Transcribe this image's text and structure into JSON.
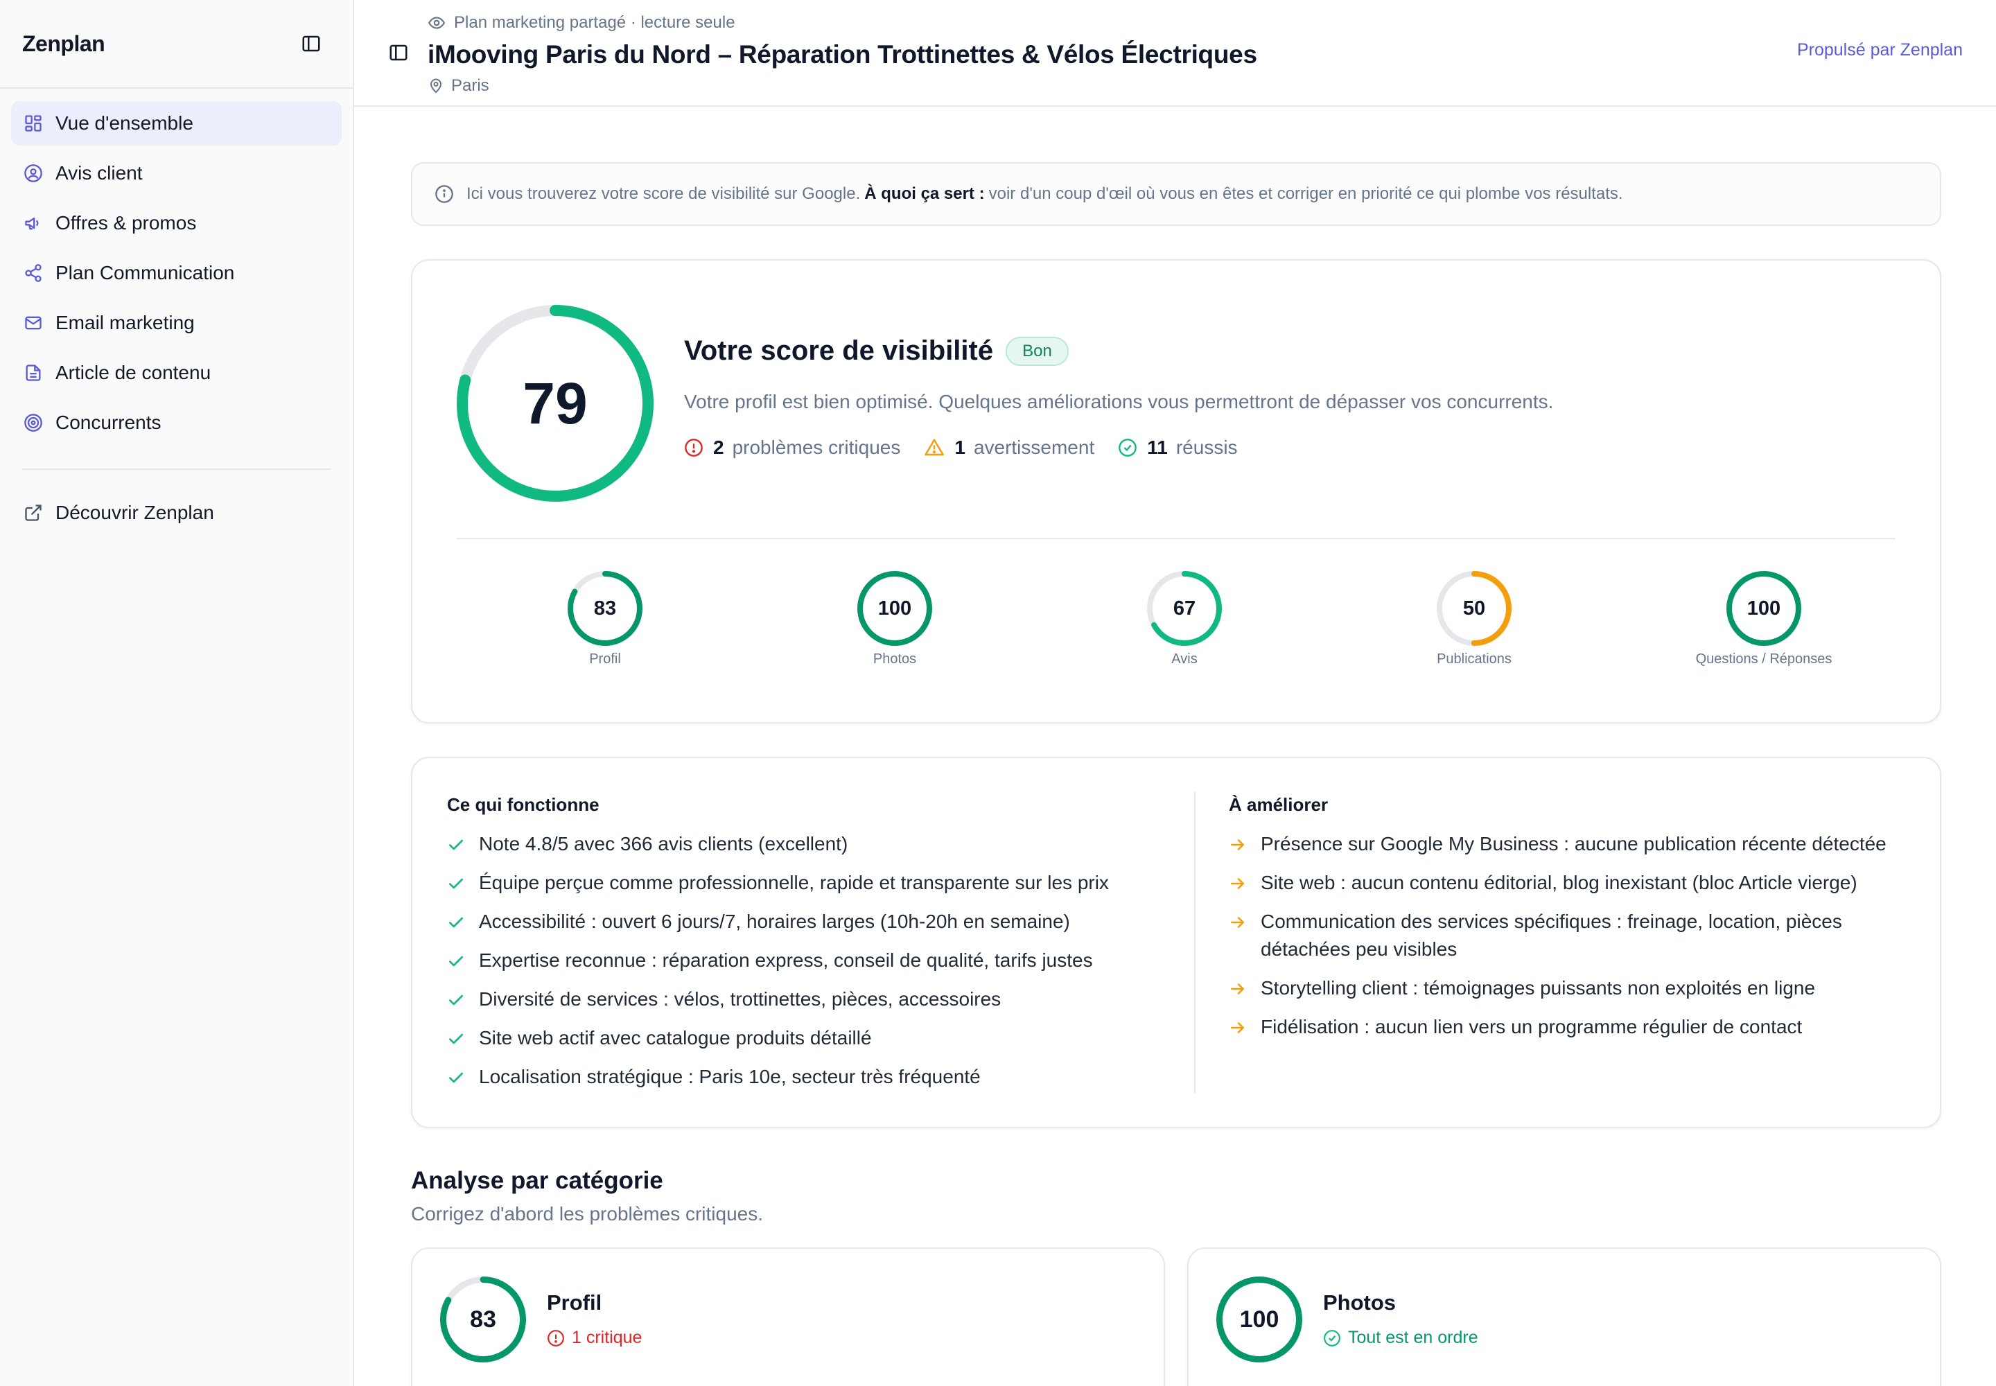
{
  "sidebar": {
    "brand": "Zenplan",
    "items": [
      {
        "label": "Vue d'ensemble",
        "icon": "dashboard-icon",
        "active": true
      },
      {
        "label": "Avis client",
        "icon": "user-circle-icon"
      },
      {
        "label": "Offres & promos",
        "icon": "megaphone-icon"
      },
      {
        "label": "Plan Communication",
        "icon": "share-icon"
      },
      {
        "label": "Email marketing",
        "icon": "mail-icon"
      },
      {
        "label": "Article de contenu",
        "icon": "document-icon"
      },
      {
        "label": "Concurrents",
        "icon": "target-icon"
      }
    ],
    "discover": {
      "label": "Découvrir Zenplan",
      "icon": "external-link-icon"
    }
  },
  "header": {
    "shared_label": "Plan marketing partagé · lecture seule",
    "title": "iMooving Paris du Nord – Réparation Trottinettes & Vélos Électriques",
    "location": "Paris",
    "powered_by": "Propulsé par Zenplan"
  },
  "info": {
    "text_before": "Ici vous trouverez votre score de visibilité sur Google.",
    "bold": "À quoi ça sert :",
    "text_after": "voir d'un coup d'œil où vous en êtes et corriger en priorité ce qui plombe vos résultats."
  },
  "score": {
    "value": 79,
    "title": "Votre score de visibilité",
    "badge": "Bon",
    "description": "Votre profil est bien optimisé. Quelques améliorations vous permettront de dépasser vos concurrents.",
    "critical_count": "2",
    "critical_label": "problèmes critiques",
    "warning_count": "1",
    "warning_label": "avertissement",
    "success_count": "11",
    "success_label": "réussis",
    "colors": {
      "green": "#10b981",
      "dark_green": "#059669",
      "orange": "#f59e0b",
      "red": "#dc2626",
      "track": "#e5e7eb"
    }
  },
  "subscores": [
    {
      "value": 83,
      "label": "Profil"
    },
    {
      "value": 100,
      "label": "Photos"
    },
    {
      "value": 67,
      "label": "Avis"
    },
    {
      "value": 50,
      "label": "Publications"
    },
    {
      "value": 100,
      "label": "Questions / Réponses"
    }
  ],
  "works": {
    "title": "Ce qui fonctionne",
    "items": [
      "Note 4.8/5 avec 366 avis clients (excellent)",
      "Équipe perçue comme professionnelle, rapide et transparente sur les prix",
      "Accessibilité : ouvert 6 jours/7, horaires larges (10h-20h en semaine)",
      "Expertise reconnue : réparation express, conseil de qualité, tarifs justes",
      "Diversité de services : vélos, trottinettes, pièces, accessoires",
      "Site web actif avec catalogue produits détaillé",
      "Localisation stratégique : Paris 10e, secteur très fréquenté"
    ]
  },
  "improve": {
    "title": "À améliorer",
    "items": [
      "Présence sur Google My Business : aucune publication récente détectée",
      "Site web : aucun contenu éditorial, blog inexistant (bloc Article vierge)",
      "Communication des services spécifiques : freinage, location, pièces détachées peu visibles",
      "Storytelling client : témoignages puissants non exploités en ligne",
      "Fidélisation : aucun lien vers un programme régulier de contact"
    ]
  },
  "analysis": {
    "title": "Analyse par catégorie",
    "subtitle": "Corrigez d'abord les problèmes critiques.",
    "cards": [
      {
        "value": 83,
        "title": "Profil",
        "status": "1 critique",
        "status_type": "critical"
      },
      {
        "value": 100,
        "title": "Photos",
        "status": "Tout est en ordre",
        "status_type": "ok"
      }
    ]
  }
}
